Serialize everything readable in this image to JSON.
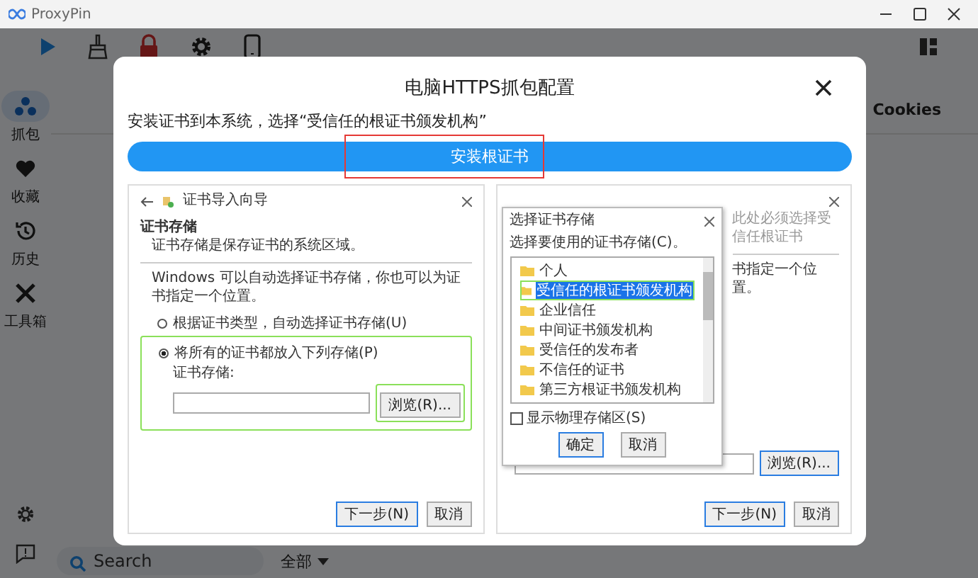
{
  "window": {
    "title": "ProxyPin"
  },
  "sidebar": {
    "items": [
      {
        "label": "抓包",
        "selected": true
      },
      {
        "label": "收藏",
        "selected": false
      },
      {
        "label": "历史",
        "selected": false
      },
      {
        "label": "工具箱",
        "selected": false
      }
    ]
  },
  "tabs": [
    {
      "label": "Cookies"
    }
  ],
  "search": {
    "placeholder": "Search"
  },
  "filter": {
    "value": "全部"
  },
  "dialog": {
    "title": "电脑HTTPS抓包配置",
    "instruction": "安装证书到本系统，选择“受信任的根证书颁发机构”",
    "install_button": "安装根证书",
    "wizard": {
      "title": "证书导入向导",
      "section_title": "证书存储",
      "section_text": "证书存储是保存证书的系统区域。",
      "paragraph": "Windows 可以自动选择证书存储，你也可以为证书指定一个位置。",
      "options": [
        {
          "label": "根据证书类型，自动选择证书存储(U)",
          "selected": false
        },
        {
          "label": "将所有的证书都放入下列存储(P)",
          "selected": true
        }
      ],
      "store_label": "证书存储:",
      "browse_button": "浏览(R)...",
      "next_button": "下一步(N)",
      "cancel_button": "取消"
    },
    "second_shot": {
      "paragraph_fragment": "书指定一个位置。",
      "browse_button": "浏览(R)...",
      "next_button": "下一步(N)",
      "cancel_button": "取消",
      "note": "此处必须选择受信任根证书",
      "picker": {
        "title": "选择证书存储",
        "prompt": "选择要使用的证书存储(C)。",
        "stores": [
          {
            "label": "个人",
            "selected": false
          },
          {
            "label": "受信任的根证书颁发机构",
            "selected": true
          },
          {
            "label": "企业信任",
            "selected": false
          },
          {
            "label": "中间证书颁发机构",
            "selected": false
          },
          {
            "label": "受信任的发布者",
            "selected": false
          },
          {
            "label": "不信任的证书",
            "selected": false
          },
          {
            "label": "第三方根证书颁发机构",
            "selected": false
          }
        ],
        "show_physical": {
          "label": "显示物理存储区(S)",
          "checked": false
        },
        "ok_button": "确定",
        "cancel_button": "取消"
      }
    }
  }
}
